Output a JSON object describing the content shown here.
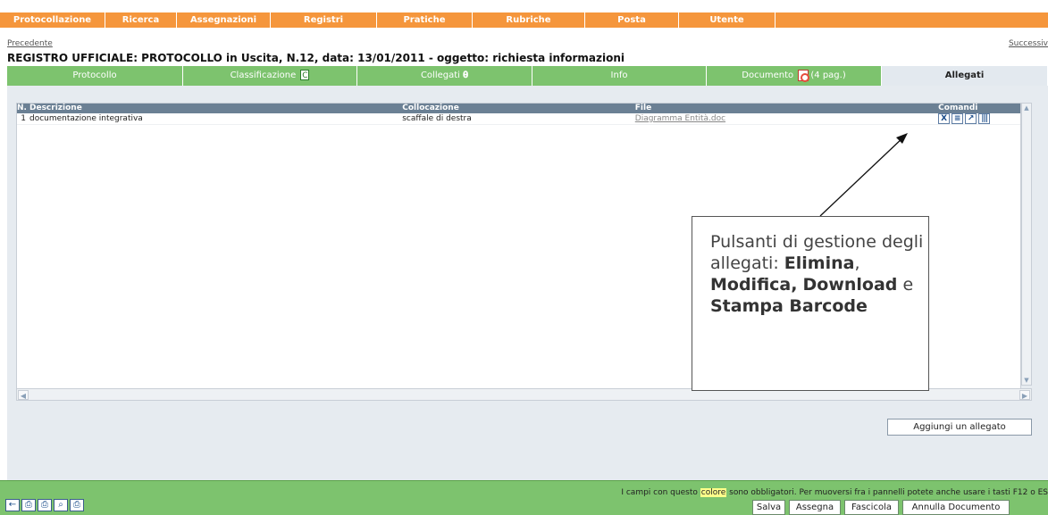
{
  "menu": {
    "items": [
      "Protocollazione",
      "Ricerca",
      "Assegnazioni",
      "Registri",
      "Pratiche",
      "Rubriche",
      "Posta",
      "Utente"
    ]
  },
  "nav": {
    "prev": "Precedente",
    "next": "Successiv"
  },
  "page_title": "REGISTRO UFFICIALE: PROTOCOLLO in Uscita, N.12, data: 13/01/2011 - oggetto: richiesta informazioni",
  "tabs": {
    "protocollo": "Protocollo",
    "classificazione": "Classificazione",
    "classificazione_badge": "C",
    "collegati": "Collegati",
    "info": "Info",
    "documento": "Documento",
    "documento_pages": "(4 pag.)",
    "allegati": "Allegati"
  },
  "grid": {
    "headers": {
      "n": "N.",
      "descrizione": "Descrizione",
      "collocazione": "Collocazione",
      "file": "File",
      "comandi": "Comandi"
    },
    "rows": [
      {
        "n": "1",
        "descrizione": "documentazione integrativa",
        "collocazione": "scaffale di destra",
        "file": "Diagramma Entità.doc"
      }
    ],
    "commands": [
      "x-delete-icon",
      "list-edit-icon",
      "download-icon",
      "barcode-icon"
    ]
  },
  "add_attachment_label": "Aggiungi un allegato",
  "callout": {
    "line1": "Pulsanti di gestione degli allegati:",
    "elimina": "Elimina",
    "modifica": "Modifica,",
    "download": "Download",
    "e": "e",
    "stampa": "Stampa Barcode"
  },
  "footer": {
    "note_pre": "I campi con questo",
    "note_hl": "colore",
    "note_post": "sono obbligatori. Per muoversi fra i pannelli potete anche usare i tasti F12 o ES",
    "buttons": {
      "salva": "Salva",
      "assegna": "Assegna",
      "fascicola": "Fascicola",
      "annulla": "Annulla Documento"
    }
  },
  "colors": {
    "menu": "#f5963c",
    "tab_green": "#7dc36e",
    "panel": "#e6ebf0",
    "grid_header": "#6b8094"
  }
}
